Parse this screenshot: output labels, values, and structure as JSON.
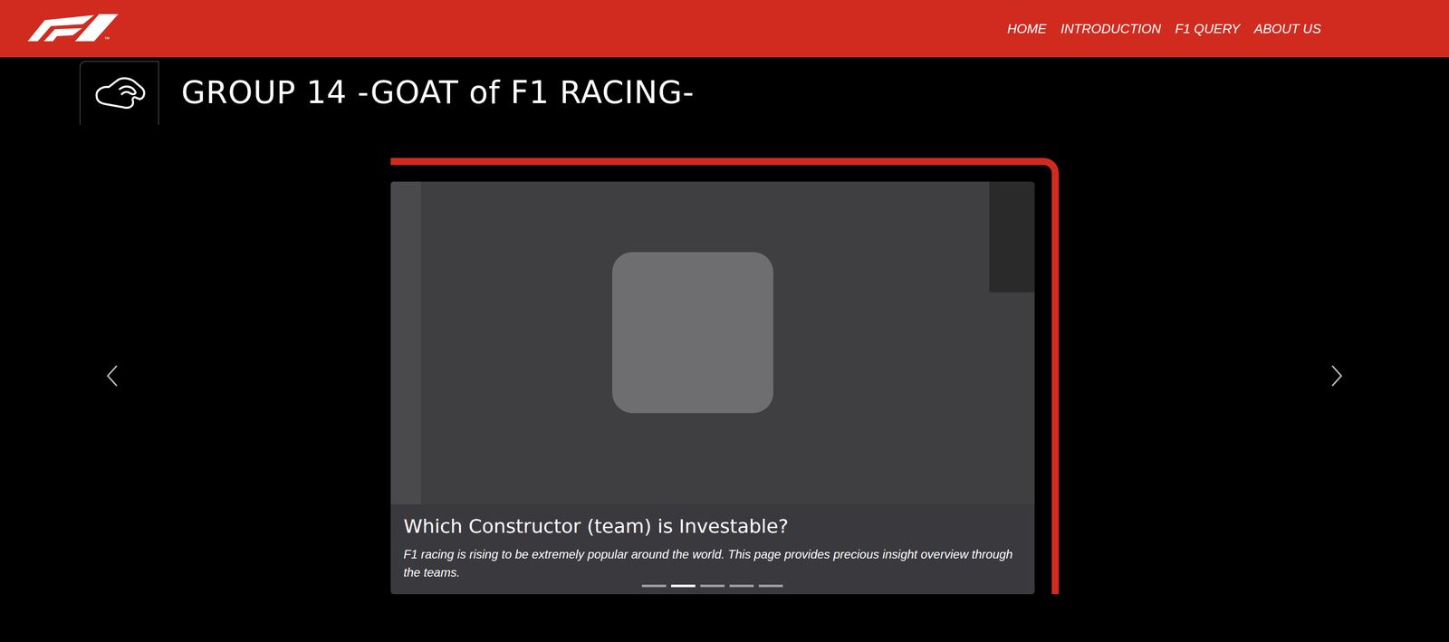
{
  "logo": {
    "mark": "™"
  },
  "nav": [
    {
      "label": "HOME"
    },
    {
      "label": "INTRODUCTION"
    },
    {
      "label": "F1 QUERY"
    },
    {
      "label": "ABOUT US"
    }
  ],
  "page_title": "GROUP 14 -GOAT of F1 RACING-",
  "carousel": {
    "caption_title": "Which Constructor (team) is Investable?",
    "caption_text": "F1 racing is rising to be extremely popular around the world. This page provides precious insight overview through the teams.",
    "indicators": [
      {
        "selected": false
      },
      {
        "selected": true
      },
      {
        "selected": false
      },
      {
        "selected": false
      },
      {
        "selected": false
      }
    ]
  }
}
